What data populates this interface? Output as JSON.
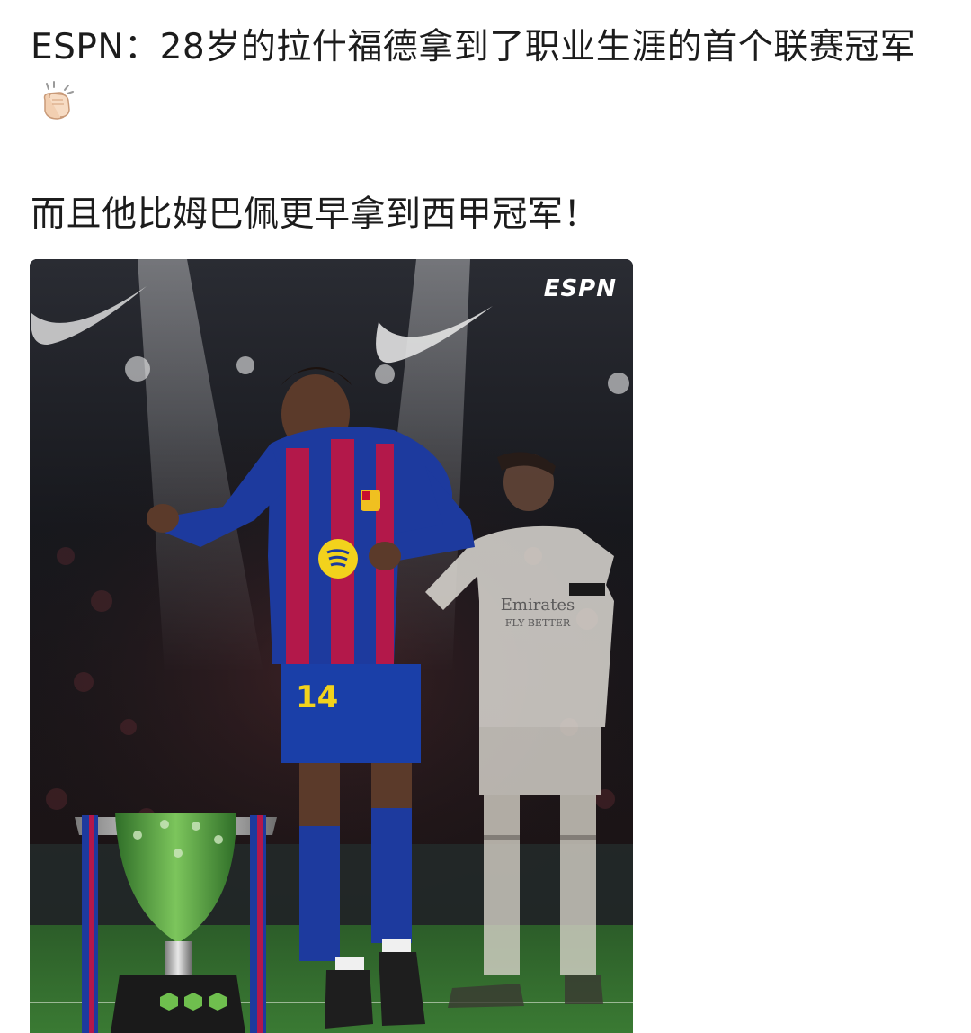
{
  "post": {
    "paragraph_1": "ESPN：28岁的拉什福德拿到了职业生涯的首个联赛冠军",
    "paragraph_2": "而且他比姆巴佩更早拿到西甲冠军！",
    "emoji": "clapping-hands-icon"
  },
  "image": {
    "watermark": "ESPN",
    "jersey_number": "14",
    "sponsor_text": "Emirates FLY BETTER",
    "colors": {
      "barca_blue": "#1d3a9e",
      "barca_red": "#b3184a",
      "real_white": "#e9e6df",
      "pitch_green": "#2f6b2c",
      "trophy_green": "#4a9a3c"
    }
  }
}
